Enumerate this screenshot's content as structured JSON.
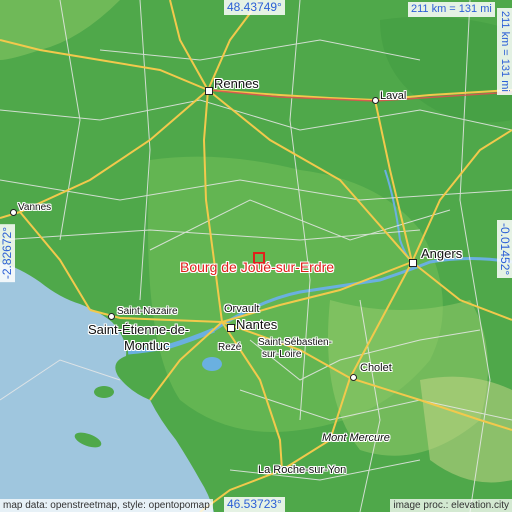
{
  "map": {
    "place_name": "Bourg de Joué-sur-Erdre",
    "colors": {
      "land": "#4fa84a",
      "sea": "#9fc6de",
      "road": "#f2c94c",
      "minor_road": "#e8e8e8",
      "river": "#6ab0e0",
      "marker": "#e0201c",
      "coords": "#2b5fd6"
    },
    "coords": {
      "north": "48.43749°",
      "south": "46.53723°",
      "west": "-2.82672°",
      "east": "-0.01452°"
    },
    "scale": {
      "top": "211 km = 131 mi",
      "right": "211 km = 131 mi"
    },
    "attribution": {
      "left": "map data: openstreetmap, style: opentopomap",
      "right": "image proc.: elevation.city"
    },
    "cities": [
      {
        "name": "Rennes",
        "size": 13
      },
      {
        "name": "Laval",
        "size": 11
      },
      {
        "name": "Vannes",
        "size": 10
      },
      {
        "name": "Angers",
        "size": 13
      },
      {
        "name": "Saint-Nazaire",
        "size": 10
      },
      {
        "name": "Saint-Étienne-de-",
        "size": 13
      },
      {
        "name": "Montluc",
        "size": 13
      },
      {
        "name": "Orvault",
        "size": 11
      },
      {
        "name": "Nantes",
        "size": 13
      },
      {
        "name": "Rezé",
        "size": 10
      },
      {
        "name": "Saint-Sébastien-",
        "size": 10
      },
      {
        "name": "sur-Loire",
        "size": 10
      },
      {
        "name": "Cholet",
        "size": 11
      },
      {
        "name": "Mont Mercure",
        "size": 11
      },
      {
        "name": "La Roche-sur-Yon",
        "size": 11
      }
    ]
  }
}
